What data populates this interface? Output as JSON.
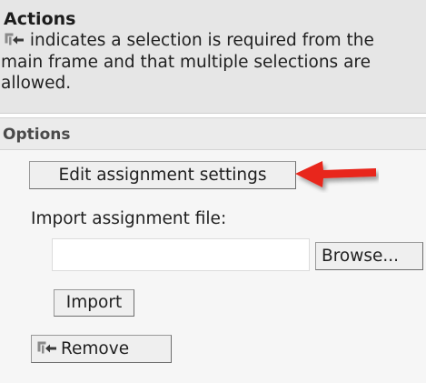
{
  "actions": {
    "title": "Actions",
    "description": "indicates a selection is required from the main frame and that multiple selections are allowed.",
    "icon": "multi-select-icon"
  },
  "options": {
    "title": "Options",
    "edit_button_label": "Edit assignment settings",
    "import_file_label": "Import assignment file:",
    "file_input_value": "",
    "browse_button_label": "Browse...",
    "import_button_label": "Import",
    "remove_button_label": "Remove",
    "remove_icon": "multi-select-icon"
  },
  "annotation": {
    "arrow_icon": "red-arrow-icon",
    "arrow_color": "#e8261c"
  },
  "colors": {
    "actions_background": "#e6e6e6",
    "options_header_background": "#ebebeb",
    "options_body_background": "#f6f6f6",
    "button_background": "#efefef"
  }
}
